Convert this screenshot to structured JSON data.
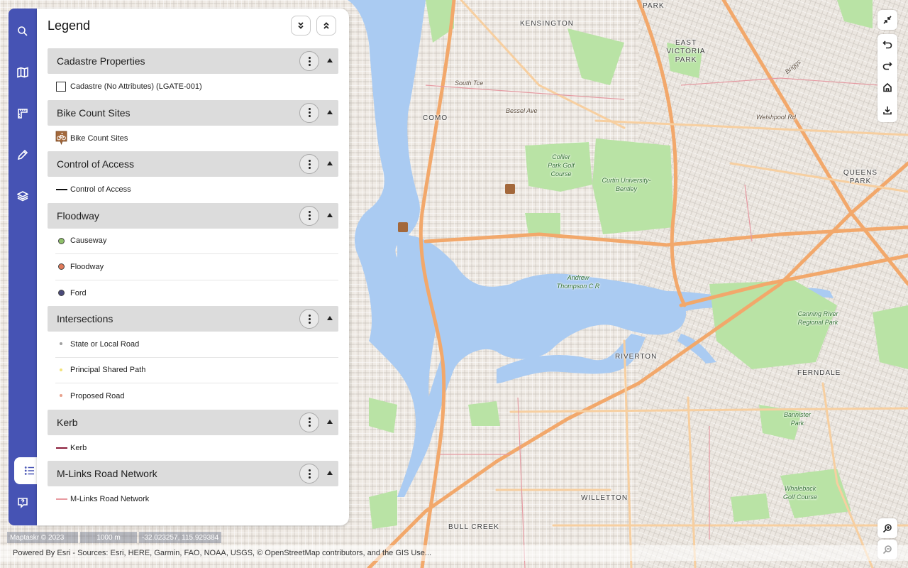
{
  "map": {
    "labels": {
      "park": "PARK",
      "kensington": "KENSINGTON",
      "east_victoria_park": "EAST VICTORIA PARK",
      "como": "COMO",
      "queens_park": "QUEENS PARK",
      "riverton": "RIVERTON",
      "ferndale": "FERNDALE",
      "willetton": "WILLETTON",
      "bull_creek": "BULL CREEK",
      "curtin": "Curtin University-Bentley",
      "collier_park": "Collier Park Golf Course",
      "canning_river": "Canning River Regional Park",
      "whaleback": "Whaleback Golf Course",
      "andrew_thompson": "Andrew Thompson C R",
      "bannister": "Bannister Park",
      "welshpool_rd": "Welshpool Rd",
      "south_tce": "South Tce",
      "bessel_ave": "Bessel Ave",
      "briggs": "Briggs"
    }
  },
  "rail": {
    "buttons": [
      {
        "name": "search-icon"
      },
      {
        "name": "map-icon"
      },
      {
        "name": "measure-icon"
      },
      {
        "name": "pencil-icon"
      },
      {
        "name": "layers-icon"
      },
      {
        "name": "legend-list-icon"
      },
      {
        "name": "help-icon"
      }
    ]
  },
  "legend": {
    "title": "Legend",
    "groups": [
      {
        "title": "Cadastre Properties",
        "items": [
          {
            "label": "Cadastre (No Attributes) (LGATE-001)",
            "symbol": "box",
            "color": "#333333"
          }
        ]
      },
      {
        "title": "Bike Count Sites",
        "items": [
          {
            "label": "Bike Count Sites",
            "symbol": "bike",
            "color": "#a3683b"
          }
        ]
      },
      {
        "title": "Control of Access",
        "items": [
          {
            "label": "Control of Access",
            "symbol": "line",
            "color": "#111111"
          }
        ]
      },
      {
        "title": "Floodway",
        "items": [
          {
            "label": "Causeway",
            "symbol": "dot",
            "color": "#8fc06a"
          },
          {
            "label": "Floodway",
            "symbol": "dot",
            "color": "#e07a5a"
          },
          {
            "label": "Ford",
            "symbol": "dot",
            "color": "#4a4a7a"
          }
        ]
      },
      {
        "title": "Intersections",
        "items": [
          {
            "label": "State or Local Road",
            "symbol": "small",
            "color": "#a0a0a0"
          },
          {
            "label": "Principal Shared Path",
            "symbol": "small",
            "color": "#f2e27a"
          },
          {
            "label": "Proposed Road",
            "symbol": "small",
            "color": "#e8a08a"
          }
        ]
      },
      {
        "title": "Kerb",
        "items": [
          {
            "label": "Kerb",
            "symbol": "line",
            "color": "#8a1c3a"
          }
        ]
      },
      {
        "title": "M-Links Road Network",
        "items": [
          {
            "label": "M-Links Road Network",
            "symbol": "line",
            "color": "#e89aa0"
          }
        ]
      }
    ]
  },
  "bottom": {
    "logo": "Maptaskr © 2023",
    "scale": "1000 m",
    "coords": "-32.023257, 115.929384",
    "attribution": "Powered By Esri - Sources: Esri, HERE, Garmin, FAO, NOAA, USGS, © OpenStreetMap contributors, and the GIS Use..."
  }
}
